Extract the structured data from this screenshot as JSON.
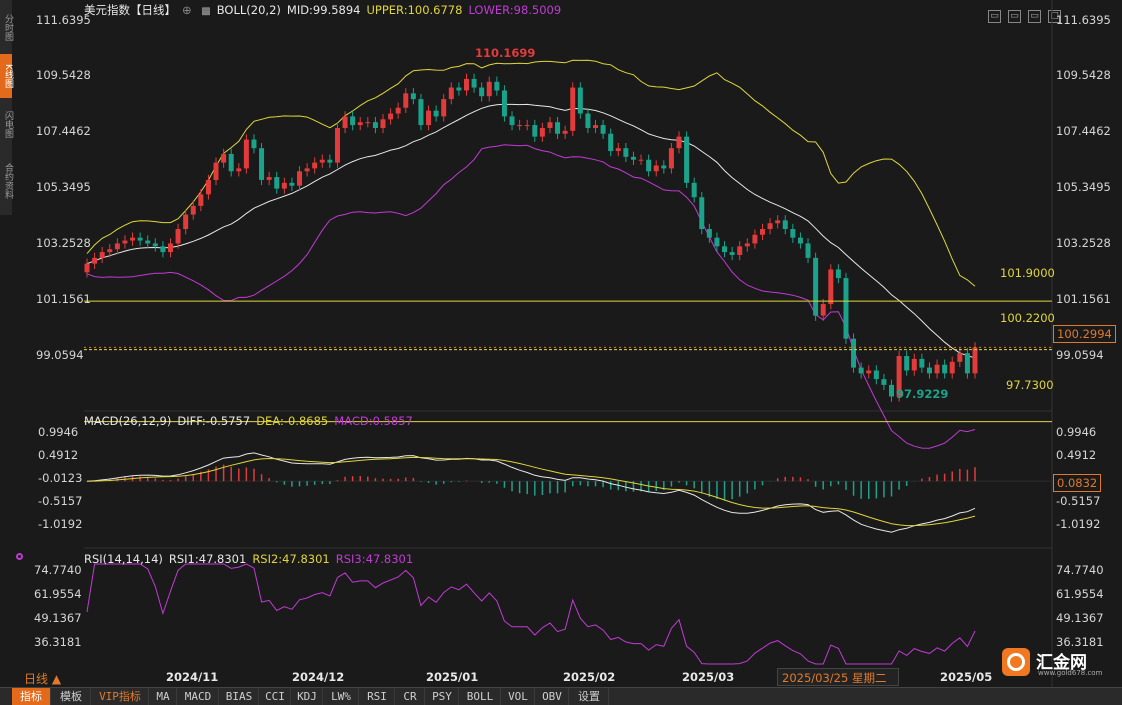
{
  "side_tabs": [
    "分时图",
    "K线图",
    "闪电图",
    "合约资料"
  ],
  "header": {
    "title": "美元指数【日线】",
    "boll_label": "BOLL(20,2)",
    "mid": "MID:99.5894",
    "upper": "UPPER:100.6778",
    "lower": "LOWER:98.5009"
  },
  "window_buttons": [
    "▭",
    "▭",
    "▭",
    "□"
  ],
  "main_yaxis": {
    "ticks": [
      "111.6395",
      "109.5428",
      "107.4462",
      "105.3495",
      "103.2528",
      "101.1561",
      "99.0594"
    ]
  },
  "annotations": {
    "high": "110.1699",
    "low": "97.9229",
    "level1": "101.9000",
    "level2": "100.2200",
    "level3": "97.7300",
    "current_price": "100.2994"
  },
  "macd": {
    "label": "MACD(26,12,9)",
    "diff": "DIFF:-0.5757",
    "dea": "DEA:-0.8685",
    "macd": "MACD:0.5857",
    "ticks": [
      "0.9946",
      "0.4912",
      "-0.0123",
      "-0.5157",
      "-1.0192"
    ],
    "current": "0.0832"
  },
  "rsi": {
    "label": "RSI(14,14,14)",
    "rsi1": "RSI1:47.8301",
    "rsi2": "RSI2:47.8301",
    "rsi3": "RSI3:47.8301",
    "ticks": [
      "74.7740",
      "61.9554",
      "49.1367",
      "36.3181"
    ]
  },
  "xaxis": {
    "labels": [
      "2024/11",
      "2024/12",
      "2025/01",
      "2025/02",
      "2025/03",
      "2025/05"
    ]
  },
  "crosshair_date": "2025/03/25 星期二",
  "line_selector": "日线 ▲",
  "logo": {
    "name": "汇金网",
    "url": "www.gold678.com"
  },
  "tabbar": [
    "指标",
    "模板",
    "VIP指标",
    "MA",
    "MACD",
    "BIAS",
    "CCI",
    "KDJ",
    "LW%",
    "RSI",
    "CR",
    "PSY",
    "BOLL",
    "VOL",
    "OBV",
    "设置"
  ],
  "colors": {
    "up": "#e23b3b",
    "down": "#1aa38a",
    "upper": "#e0d63a",
    "mid": "#e8e8e8",
    "lower": "#c23ad6",
    "level": "#e0d63a",
    "accent": "#e26a1a"
  },
  "chart_data": {
    "type": "candlestick",
    "close": [
      103.2,
      103.4,
      103.6,
      103.7,
      103.9,
      104.0,
      104.1,
      104.0,
      103.9,
      103.8,
      103.6,
      103.9,
      104.4,
      104.9,
      105.2,
      105.6,
      106.1,
      106.7,
      107.0,
      106.4,
      106.5,
      107.5,
      107.2,
      106.1,
      106.2,
      105.8,
      106.0,
      105.9,
      106.4,
      106.5,
      106.7,
      106.8,
      106.7,
      107.9,
      108.3,
      108.0,
      108.1,
      108.1,
      107.9,
      108.2,
      108.4,
      108.6,
      109.1,
      108.9,
      108.0,
      108.5,
      108.3,
      108.9,
      109.3,
      109.2,
      109.6,
      109.3,
      109.0,
      109.5,
      109.2,
      108.3,
      108.0,
      108.0,
      108.0,
      107.6,
      107.9,
      108.1,
      107.7,
      107.8,
      109.3,
      108.4,
      107.9,
      108.0,
      107.7,
      107.1,
      107.2,
      106.9,
      106.8,
      106.8,
      106.4,
      106.6,
      106.5,
      107.2,
      107.6,
      106.0,
      105.5,
      104.4,
      104.1,
      103.8,
      103.6,
      103.5,
      103.8,
      103.9,
      104.2,
      104.4,
      104.6,
      104.7,
      104.4,
      104.1,
      103.9,
      103.4,
      101.4,
      101.8,
      103.0,
      102.7,
      100.6,
      99.6,
      99.4,
      99.5,
      99.2,
      99.0,
      98.6,
      100.0,
      99.5,
      99.9,
      99.6,
      99.4,
      99.7,
      99.4,
      99.8,
      100.1,
      99.4,
      100.3
    ],
    "upper_band_range": [
      103.5,
      110.4
    ],
    "lower_band_range": [
      99.1,
      108.2
    ],
    "yrange": [
      98.2,
      111.64
    ],
    "levels": [
      101.9,
      100.22,
      97.73
    ],
    "macd_range": [
      -1.25,
      1.1
    ],
    "rsi_range": [
      28,
      80
    ]
  }
}
